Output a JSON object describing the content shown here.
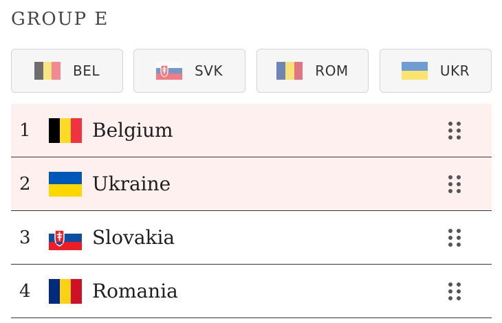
{
  "group": {
    "title": "GROUP E"
  },
  "chips": [
    {
      "code": "BEL",
      "flag": "belgium-flag"
    },
    {
      "code": "SVK",
      "flag": "slovakia-flag"
    },
    {
      "code": "ROM",
      "flag": "romania-flag"
    },
    {
      "code": "UKR",
      "flag": "ukraine-flag"
    }
  ],
  "standings": [
    {
      "position": "1",
      "team": "Belgium",
      "flag": "belgium-flag",
      "highlighted": true
    },
    {
      "position": "2",
      "team": "Ukraine",
      "flag": "ukraine-flag",
      "highlighted": true
    },
    {
      "position": "3",
      "team": "Slovakia",
      "flag": "slovakia-flag",
      "highlighted": false
    },
    {
      "position": "4",
      "team": "Romania",
      "flag": "romania-flag",
      "highlighted": false
    }
  ],
  "colors": {
    "highlight_row": "#fdf0ef",
    "belgium": [
      "#000000",
      "#fdda24",
      "#ef3340"
    ],
    "romania": [
      "#002b7f",
      "#fcd116",
      "#ce1126"
    ],
    "ukraine": [
      "#0057b7",
      "#ffd700"
    ],
    "slovakia": [
      "#ffffff",
      "#0b4ea2",
      "#ee1c25"
    ]
  },
  "icons": {
    "drag_handle": "drag-handle-icon"
  }
}
